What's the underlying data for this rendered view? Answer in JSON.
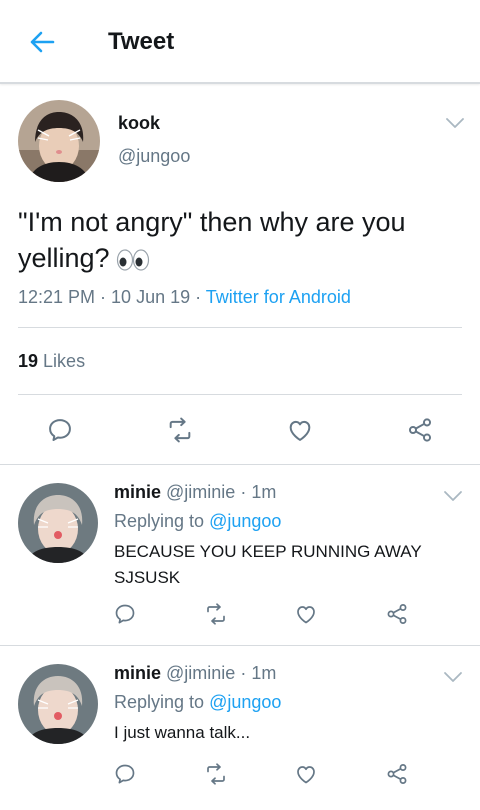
{
  "header": {
    "title": "Tweet"
  },
  "tweet": {
    "name": "kook",
    "handle": "@jungoo",
    "text": "\"I'm not angry\" then why are you yelling?",
    "time": "12:21 PM",
    "date": "10 Jun 19",
    "source": "Twitter for Android",
    "likes_count": "19",
    "likes_label": "Likes"
  },
  "replies": [
    {
      "name": "minie",
      "handle": "@jiminie",
      "time": "1m",
      "replying_label": "Replying to",
      "replying_to": "@jungoo",
      "text": "BECAUSE YOU KEEP RUNNING AWAY SJSUSK"
    },
    {
      "name": "minie",
      "handle": "@jiminie",
      "time": "1m",
      "replying_label": "Replying to",
      "replying_to": "@jungoo",
      "text": "I just wanna talk..."
    }
  ],
  "colors": {
    "accent": "#1da1f2",
    "secondary_text": "#657786",
    "icon_gray": "#657786"
  },
  "icons": [
    "back-arrow-icon",
    "chevron-down-icon",
    "reply-icon",
    "retweet-icon",
    "like-icon",
    "share-icon",
    "eyes-emoji-icon"
  ]
}
